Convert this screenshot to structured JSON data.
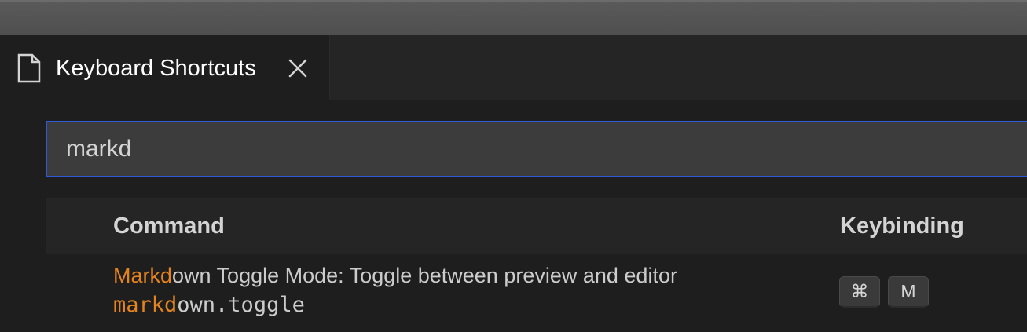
{
  "tab": {
    "title": "Keyboard Shortcuts",
    "icon": "file-icon"
  },
  "search": {
    "value": "markd"
  },
  "table": {
    "headers": {
      "command": "Command",
      "keybinding": "Keybinding"
    },
    "rows": [
      {
        "title_match": "Markd",
        "title_rest": "own Toggle Mode: Toggle between preview and editor",
        "id_match": "markd",
        "id_rest": "own.toggle",
        "keys": [
          "⌘",
          "M"
        ]
      }
    ]
  },
  "colors": {
    "highlight": "#e5841f",
    "focus_border": "#2f5bd8",
    "background": "#1e1e1e"
  }
}
